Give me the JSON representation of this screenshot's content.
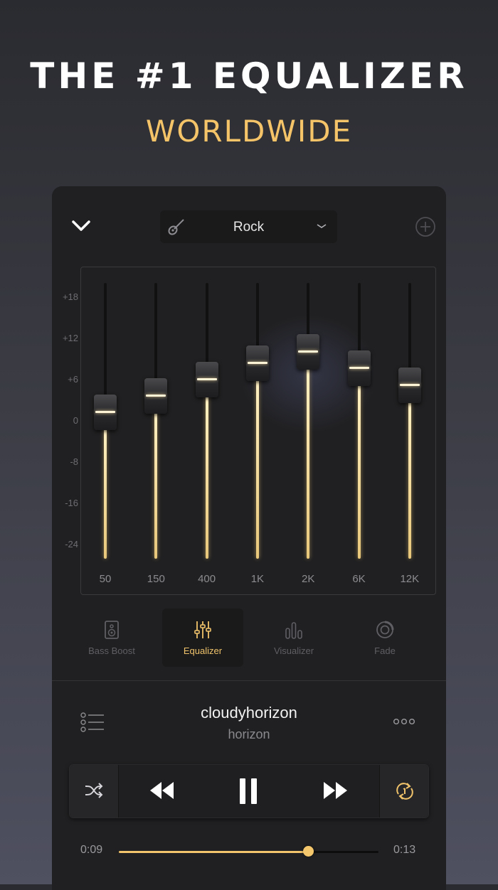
{
  "headline": {
    "title": "THE #1 EQUALIZER",
    "subtitle": "WORLDWIDE"
  },
  "colors": {
    "accent": "#f5c469",
    "panel": "#202022"
  },
  "preset": {
    "name": "Rock",
    "icon": "guitar-icon"
  },
  "eq": {
    "db_labels": [
      "+18",
      "+12",
      "+6",
      "0",
      "-8",
      "-16",
      "-24"
    ],
    "bands": [
      {
        "freq": "50",
        "level": 0.53
      },
      {
        "freq": "150",
        "level": 0.59
      },
      {
        "freq": "400",
        "level": 0.65
      },
      {
        "freq": "1K",
        "level": 0.71
      },
      {
        "freq": "2K",
        "level": 0.75
      },
      {
        "freq": "6K",
        "level": 0.69
      },
      {
        "freq": "12K",
        "level": 0.63
      }
    ]
  },
  "tabs": [
    {
      "label": "Bass Boost",
      "icon": "speaker-icon",
      "active": false
    },
    {
      "label": "Equalizer",
      "icon": "sliders-icon",
      "active": true
    },
    {
      "label": "Visualizer",
      "icon": "bars-icon",
      "active": false
    },
    {
      "label": "Fade",
      "icon": "fade-ring-icon",
      "active": false
    }
  ],
  "track": {
    "title": "cloudyhorizon",
    "artist": "horizon"
  },
  "player": {
    "elapsed": "0:09",
    "remaining": "0:13",
    "progress": 0.73,
    "state": "playing"
  }
}
